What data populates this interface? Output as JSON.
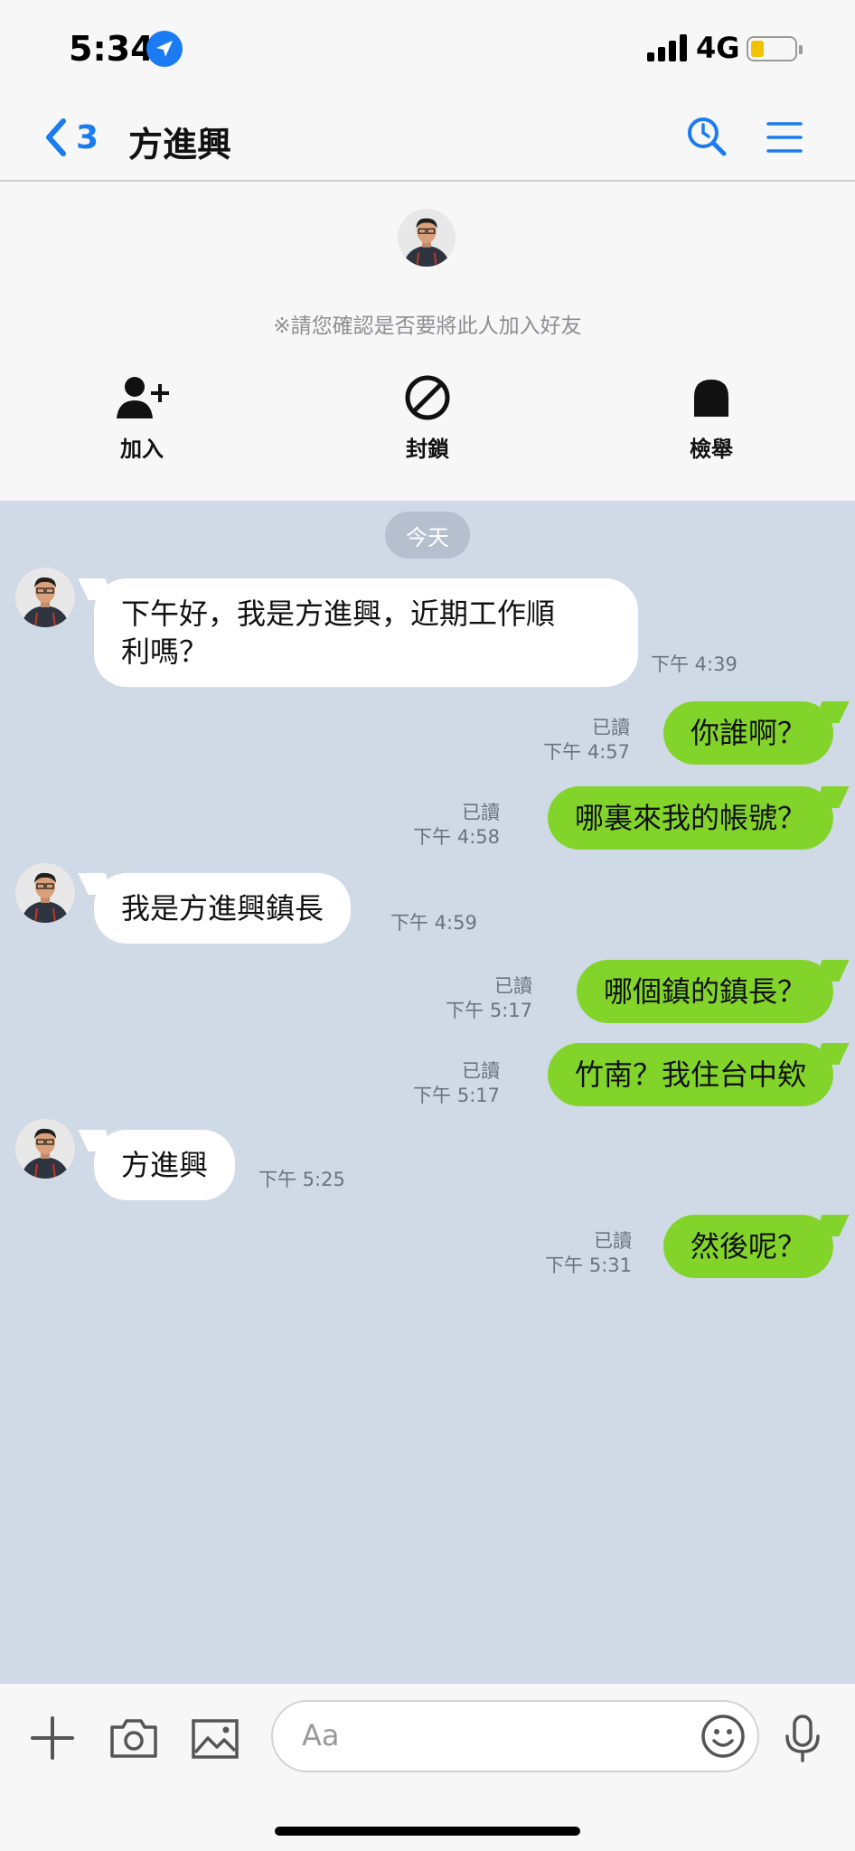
{
  "status_bar": {
    "time": "5:34",
    "network": "4G"
  },
  "nav": {
    "back_count": "3",
    "title": "方進興"
  },
  "panel": {
    "note": "※請您確認是否要將此人加入好友",
    "actions": [
      {
        "label": "加入",
        "icon": "add-friend-icon"
      },
      {
        "label": "封鎖",
        "icon": "block-icon"
      },
      {
        "label": "檢舉",
        "icon": "report-icon"
      }
    ]
  },
  "chat": {
    "day": "今天",
    "messages": [
      {
        "dir": "in",
        "text_line1": "下午好，我是方進興，近期工作順",
        "text_line2": "利嗎？",
        "time": "下午 4:39"
      },
      {
        "dir": "out",
        "text": "你誰啊？",
        "read": "已讀",
        "time": "下午 4:57"
      },
      {
        "dir": "out",
        "text": "哪裏來我的帳號？",
        "read": "已讀",
        "time": "下午 4:58"
      },
      {
        "dir": "in",
        "text": "我是方進興鎮長",
        "time": "下午 4:59"
      },
      {
        "dir": "out",
        "text": "哪個鎮的鎮長？",
        "read": "已讀",
        "time": "下午 5:17"
      },
      {
        "dir": "out",
        "text": "竹南？我住台中欸",
        "read": "已讀",
        "time": "下午 5:17"
      },
      {
        "dir": "in",
        "text": "方進興",
        "time": "下午 5:25"
      },
      {
        "dir": "out",
        "text": "然後呢？",
        "read": "已讀",
        "time": "下午 5:31"
      }
    ]
  },
  "input": {
    "placeholder": "Aa"
  },
  "colors": {
    "accent": "#1b7cf0",
    "outgoing_bubble": "#82d42a",
    "chat_background": "#d0d9e6"
  }
}
